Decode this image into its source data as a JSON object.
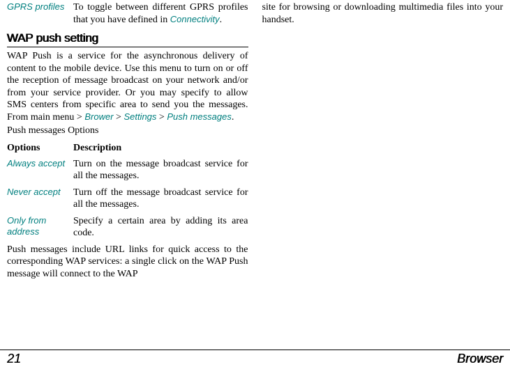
{
  "left": {
    "gprs": {
      "name": "GPRS profiles",
      "desc_pre": "To toggle between different GPRS profiles that you have defined in ",
      "desc_link": "Connectivity",
      "desc_post": "."
    },
    "heading": "WAP push setting",
    "para_pre": "WAP Push is a service for the asynchronous delivery of content to the mobile device. Use this menu to turn on or off the reception of message broadcast on your network and/or from your service provider. Or you may specify to allow SMS centers from specific area to send you the messages. From main menu > ",
    "para_link1": "Brower",
    "para_mid1": " > ",
    "para_link2": "Settings",
    "para_mid2": " > ",
    "para_link3": "Push messages",
    "para_post": ".",
    "subhead": "Push messages Options",
    "table_head": {
      "c1": "Options",
      "c2": "Description"
    },
    "rows": [
      {
        "name": "Always accept",
        "desc": "Turn on the message broadcast service for all the messages."
      },
      {
        "name": "Never accept",
        "desc": "Turn off the message broadcast service for all the messages."
      },
      {
        "name": "Only from address",
        "desc": "Specify a certain area by adding its area code."
      }
    ],
    "tail": "Push messages include URL links for quick access to the corresponding WAP services: a single click on the WAP Push message will connect to the WAP"
  },
  "right": {
    "cont": "site for browsing or downloading multimedia files into your handset."
  },
  "footer": {
    "page": "21",
    "title": "Browser"
  }
}
